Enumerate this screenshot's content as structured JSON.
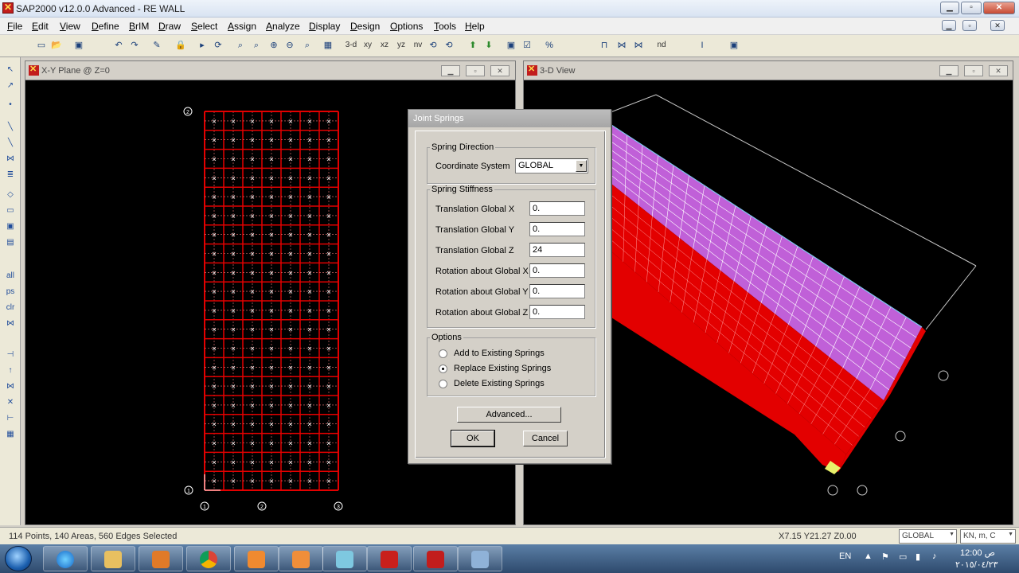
{
  "window": {
    "title": "SAP2000 v12.0.0 Advanced  - RE WALL"
  },
  "menu": [
    "File",
    "Edit",
    "View",
    "Define",
    "BrIM",
    "Draw",
    "Select",
    "Assign",
    "Analyze",
    "Display",
    "Design",
    "Options",
    "Tools",
    "Help"
  ],
  "toolbar": {
    "view_3d": "3-d",
    "view_xy": "xy",
    "view_xz": "xz",
    "view_yz": "yz",
    "view_nv": "nv",
    "view_nd": "nd"
  },
  "left_pane": {
    "title": "X-Y Plane @ Z=0",
    "grid_top": "2",
    "grid_left": "1",
    "grid_bottom": [
      "1",
      "2",
      "3"
    ]
  },
  "right_pane": {
    "title": "3-D View"
  },
  "dialog": {
    "title": "Joint Springs",
    "spring_direction": {
      "label": "Spring Direction",
      "coordinate_system_label": "Coordinate System",
      "coordinate_system_value": "GLOBAL"
    },
    "spring_stiffness": {
      "label": "Spring Stiffness",
      "rows": [
        {
          "label": "Translation Global X",
          "value": "0."
        },
        {
          "label": "Translation Global Y",
          "value": "0."
        },
        {
          "label": "Translation Global Z",
          "value": "24"
        },
        {
          "label": "Rotation about Global X",
          "value": "0."
        },
        {
          "label": "Rotation about Global Y",
          "value": "0."
        },
        {
          "label": "Rotation about Global Z",
          "value": "0."
        }
      ]
    },
    "options": {
      "label": "Options",
      "items": [
        {
          "label": "Add to Existing Springs",
          "selected": false
        },
        {
          "label": "Replace Existing Springs",
          "selected": true
        },
        {
          "label": "Delete Existing Springs",
          "selected": false
        }
      ]
    },
    "advanced_button": "Advanced...",
    "ok_button": "OK",
    "cancel_button": "Cancel"
  },
  "status": {
    "selection": "114 Points, 140 Areas, 560 Edges Selected",
    "coords": "X7.15  Y21.27  Z0.00",
    "coord_system": "GLOBAL",
    "units": "KN, m, C"
  },
  "taskbar": {
    "language": "EN",
    "time": "12:00 ص",
    "date": "٢٠١٥/٠٤/٢٣",
    "apps": [
      "internet-explorer",
      "file-explorer",
      "media-player",
      "chrome",
      "orange-app",
      "camera-app",
      "notes-app",
      "pdf-reader",
      "sap2000",
      "paint-app"
    ]
  },
  "colors": {
    "mesh_red": "#e30000",
    "wall_magenta": "#c060d8",
    "grid_line": "#ffffff",
    "background": "#000000"
  }
}
